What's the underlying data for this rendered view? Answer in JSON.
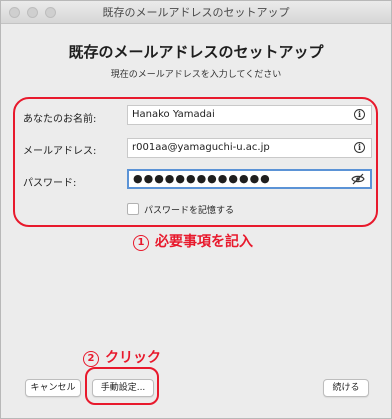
{
  "window": {
    "title": "既存のメールアドレスのセットアップ",
    "traffic_lights": [
      "close",
      "minimize",
      "zoom"
    ]
  },
  "main": {
    "heading": "既存のメールアドレスのセットアップ",
    "subheading": "現在のメールアドレスを入力してください"
  },
  "form": {
    "name": {
      "label": "あなたのお名前:",
      "value": "Hanako Yamadai",
      "icon": "info-icon"
    },
    "email": {
      "label": "メールアドレス:",
      "value": "r001aa@yamaguchi-u.ac.jp",
      "icon": "info-icon"
    },
    "password": {
      "label": "パスワード:",
      "value": "●●●●●●●●●●●●●",
      "icon": "eye-slash-icon"
    },
    "remember": {
      "label": "パスワードを記憶する",
      "checked": false
    }
  },
  "annotations": {
    "step1_number": "①",
    "step1_text": "必要事項を記入",
    "step2_number": "②",
    "step2_text": "クリック",
    "color": "#e8192c"
  },
  "buttons": {
    "cancel": "キャンセル",
    "manual": "手動設定...",
    "continue": "続ける"
  }
}
